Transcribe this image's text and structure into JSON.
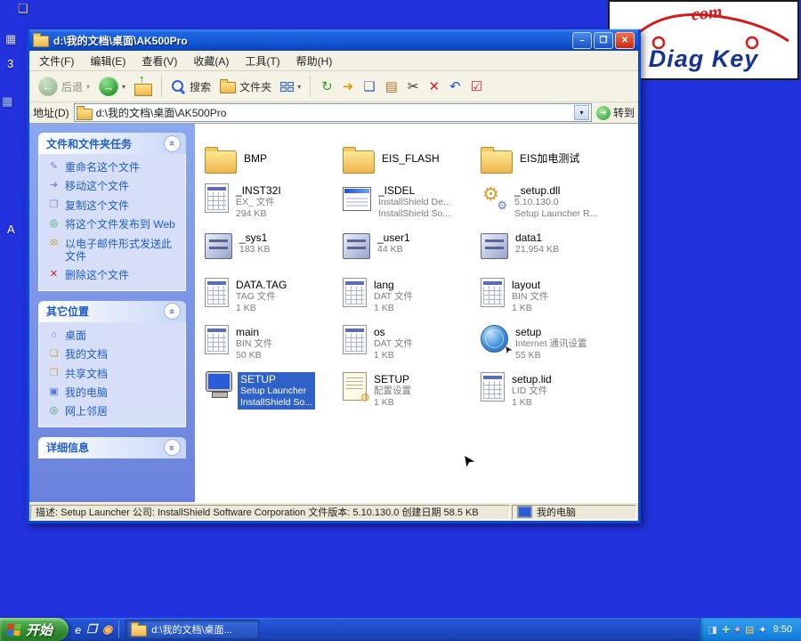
{
  "logo": {
    "top": "com",
    "brand": "Diag Key"
  },
  "desktop_icons": [
    {
      "name": "desktop-edge-icon",
      "glyph": "❏",
      "color": "#f5d66a"
    },
    {
      "name": "desktop-edge-icon",
      "glyph": "▦",
      "color": "#cfd6e8"
    },
    {
      "name": "desktop-edge-icon",
      "glyph": "3",
      "color": "#ffffff"
    },
    {
      "name": "desktop-edge-icon",
      "glyph": "▦",
      "color": "#9fc0ff"
    },
    {
      "name": "desktop-edge-icon",
      "glyph": "A",
      "color": "#ffffff"
    }
  ],
  "window": {
    "title": "d:\\我的文档\\桌面\\AK500Pro",
    "menus": [
      "文件(F)",
      "编辑(E)",
      "查看(V)",
      "收藏(A)",
      "工具(T)",
      "帮助(H)"
    ],
    "toolbar": {
      "back_label": "后退",
      "search_label": "搜索",
      "folders_label": "文件夹",
      "icons": [
        {
          "name": "refresh-icon",
          "glyph": "↻",
          "color": "#2e9e2e"
        },
        {
          "name": "move-to-icon",
          "glyph": "➜",
          "color": "#d8a020"
        },
        {
          "name": "copy-to-icon",
          "glyph": "❏",
          "color": "#3a62c8"
        },
        {
          "name": "paste-icon",
          "glyph": "▤",
          "color": "#b07838"
        },
        {
          "name": "cut-icon",
          "glyph": "✂",
          "color": "#333333"
        },
        {
          "name": "delete-icon",
          "glyph": "✕",
          "color": "#d42020"
        },
        {
          "name": "undo-icon",
          "glyph": "↶",
          "color": "#2850c8"
        },
        {
          "name": "check-icon",
          "glyph": "☑",
          "color": "#d42020"
        }
      ]
    },
    "address": {
      "label": "地址(D)",
      "value": "d:\\我的文档\\桌面\\AK500Pro",
      "go_label": "转到"
    },
    "sidebar": {
      "panels": [
        {
          "title": "文件和文件夹任务",
          "collapsed": false,
          "items": [
            {
              "label": "重命名这个文件",
              "icon": "rename-icon",
              "glyph": "✎",
              "color": "#7a86c8"
            },
            {
              "label": "移动这个文件",
              "icon": "move-file-icon",
              "glyph": "➜",
              "color": "#7a86c8"
            },
            {
              "label": "复制这个文件",
              "icon": "copy-file-icon",
              "glyph": "❐",
              "color": "#7a86c8"
            },
            {
              "label": "将这个文件发布到 Web",
              "icon": "publish-web-icon",
              "glyph": "◎",
              "color": "#3a9e5e"
            },
            {
              "label": "以电子邮件形式发送此文件",
              "icon": "email-icon",
              "glyph": "✉",
              "color": "#c8a24a"
            },
            {
              "label": "删除这个文件",
              "icon": "delete-file-icon",
              "glyph": "✕",
              "color": "#d42020"
            }
          ]
        },
        {
          "title": "其它位置",
          "collapsed": false,
          "items": [
            {
              "label": "桌面",
              "icon": "desktop-icon",
              "glyph": "⌂",
              "color": "#7a86c8"
            },
            {
              "label": "我的文档",
              "icon": "my-documents-icon",
              "glyph": "❏",
              "color": "#c8a24a"
            },
            {
              "label": "共享文档",
              "icon": "shared-documents-icon",
              "glyph": "❐",
              "color": "#c8a24a"
            },
            {
              "label": "我的电脑",
              "icon": "my-computer-icon",
              "glyph": "▣",
              "color": "#5a78d8"
            },
            {
              "label": "网上邻居",
              "icon": "network-places-icon",
              "glyph": "◎",
              "color": "#3a9e5e"
            }
          ]
        },
        {
          "title": "详细信息",
          "collapsed": true,
          "items": []
        }
      ]
    },
    "files": [
      {
        "name": "BMP",
        "lines": [],
        "icon": "folder-icon"
      },
      {
        "name": "EIS_FLASH",
        "lines": [],
        "icon": "folder-icon"
      },
      {
        "name": "EIS加电测试",
        "lines": [],
        "icon": "folder-icon"
      },
      {
        "name": "_INST32I",
        "lines": [
          "EX_ 文件",
          "294 KB"
        ],
        "icon": "grid-file-icon"
      },
      {
        "name": "_ISDEL",
        "lines": [
          "InstallShield De...",
          "InstallShield So..."
        ],
        "icon": "app-window-icon"
      },
      {
        "name": "_setup.dll",
        "lines": [
          "5.10.130.0",
          "Setup Launcher R..."
        ],
        "icon": "dll-gear-icon"
      },
      {
        "name": "_sys1",
        "lines": [
          "183 KB"
        ],
        "icon": "cabinet-icon"
      },
      {
        "name": "_user1",
        "lines": [
          "44 KB"
        ],
        "icon": "cabinet-icon"
      },
      {
        "name": "data1",
        "lines": [
          "21,954 KB"
        ],
        "icon": "cabinet-icon"
      },
      {
        "name": "DATA.TAG",
        "lines": [
          "TAG 文件",
          "1 KB"
        ],
        "icon": "grid-file-icon"
      },
      {
        "name": "lang",
        "lines": [
          "DAT 文件",
          "1 KB"
        ],
        "icon": "grid-file-icon"
      },
      {
        "name": "layout",
        "lines": [
          "BIN 文件",
          "1 KB"
        ],
        "icon": "grid-file-icon"
      },
      {
        "name": "main",
        "lines": [
          "BIN 文件",
          "50 KB"
        ],
        "icon": "grid-file-icon"
      },
      {
        "name": "os",
        "lines": [
          "DAT 文件",
          "1 KB"
        ],
        "icon": "grid-file-icon"
      },
      {
        "name": "setup",
        "lines": [
          "Internet 通讯设置",
          "55 KB"
        ],
        "icon": "globe-icon"
      },
      {
        "name": "SETUP",
        "lines": [
          "Setup Launcher",
          "InstallShield So..."
        ],
        "icon": "monitor-icon",
        "selected": true
      },
      {
        "name": "SETUP",
        "lines": [
          "配置设置",
          "1 KB"
        ],
        "icon": "config-gear-icon"
      },
      {
        "name": "setup.lid",
        "lines": [
          "LID 文件",
          "1 KB"
        ],
        "icon": "grid-file-icon"
      }
    ],
    "statusbar": {
      "left": "描述: Setup Launcher 公司: InstallShield Software Corporation 文件版本: 5.10.130.0 创建日期 58.5 KB",
      "right": "我的电脑"
    }
  },
  "taskbar": {
    "start_label": "开始",
    "task_label": "d:\\我的文档\\桌面...",
    "time": "9:50",
    "quick_launch": [
      {
        "name": "ie-icon",
        "glyph": "e",
        "color": "#bfe0ff"
      },
      {
        "name": "show-desktop-icon",
        "glyph": "❐",
        "color": "#dfe8ff"
      },
      {
        "name": "media-player-icon",
        "glyph": "◉",
        "color": "#ffb860"
      }
    ],
    "tray_icons": [
      {
        "name": "tray-icon",
        "glyph": "◨",
        "color": "#cfe0ff"
      },
      {
        "name": "tray-icon",
        "glyph": "✚",
        "color": "#9fe09f"
      },
      {
        "name": "tray-icon",
        "glyph": "●",
        "color": "#ff9f9f"
      },
      {
        "name": "tray-icon",
        "glyph": "▤",
        "color": "#ffe08f"
      },
      {
        "name": "tray-icon",
        "glyph": "✦",
        "color": "#ffffff"
      }
    ]
  },
  "colors": {
    "selection": "#2f62c9",
    "desktop": "#2232dc",
    "titlebar": "#155ad8"
  }
}
